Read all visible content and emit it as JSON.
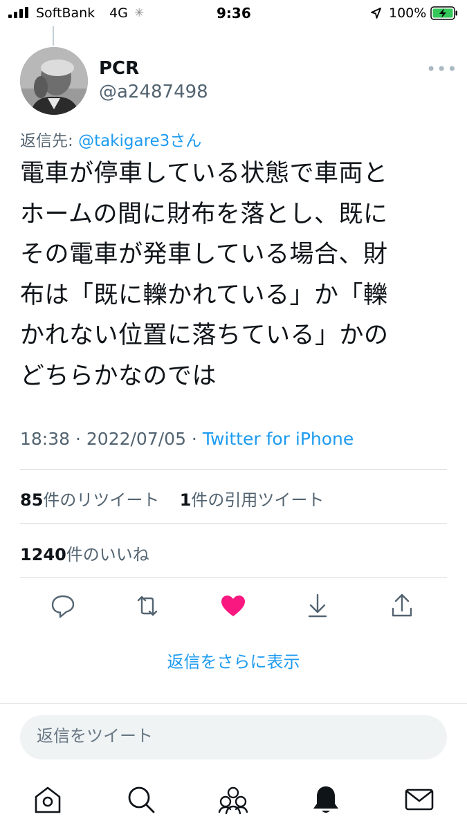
{
  "status_bar": {
    "carrier": "SoftBank",
    "network": "4G",
    "time": "9:36",
    "battery_percent": "100%",
    "battery_level": 1.0,
    "icons": [
      "signal-bars-icon",
      "loading-spinner-icon",
      "location-arrow-icon",
      "battery-charging-icon"
    ]
  },
  "tweet": {
    "author_name": "PCR",
    "author_handle": "@a2487498",
    "reply_prefix": "返信先: ",
    "reply_mention": "@takigare3さん",
    "lines": [
      "電車が停車している状態で車両と",
      "ホームの間に財布を落とし、既に",
      "その電車が発車している場合、財",
      "布は「既に轢かれている」か「轢",
      "かれない位置に落ちている」かの",
      "どちらかなのでは"
    ],
    "time": "18:38",
    "separator": " · ",
    "date": "2022/07/05",
    "app": "Twitter for iPhone"
  },
  "stats": {
    "retweets_count": "85",
    "retweets_label": "件のリツイート",
    "quotes_count": "1",
    "quotes_label": "件の引用ツイート",
    "likes_count": "1240",
    "likes_label": "件のいいね"
  },
  "actions": {
    "icons": [
      "reply-icon",
      "retweet-icon",
      "like-heart-icon",
      "download-icon",
      "share-icon"
    ],
    "like_color": "#f91880",
    "liked": true
  },
  "more_replies": "返信をさらに表示",
  "compose": {
    "placeholder": "返信をツイート"
  },
  "tab_bar": {
    "icons": [
      "home-icon",
      "search-icon",
      "communities-icon",
      "notifications-bell-icon",
      "messages-envelope-icon"
    ],
    "active": "notifications"
  },
  "colors": {
    "accent": "#1d9bf0",
    "text": "#0f1419",
    "secondary": "#536471"
  }
}
